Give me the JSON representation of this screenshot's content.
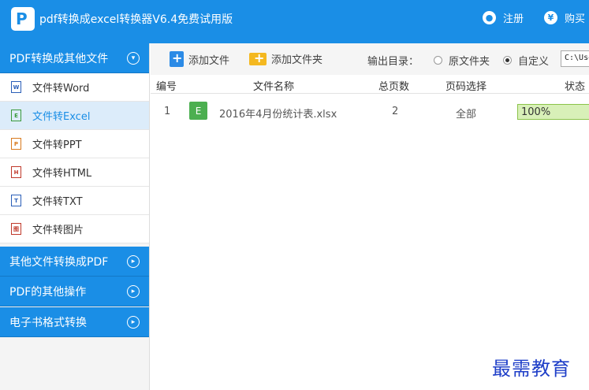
{
  "app": {
    "title": "pdf转换成excel转换器V6.4免费试用版",
    "logo_icon": "pdf-logo-icon"
  },
  "top_actions": {
    "register": "注册",
    "buy": "购买"
  },
  "sidebar": {
    "cat_pdf_to_other": "PDF转换成其他文件",
    "items": [
      {
        "label": "文件转Word",
        "icon": "W"
      },
      {
        "label": "文件转Excel",
        "icon": "E"
      },
      {
        "label": "文件转PPT",
        "icon": "P"
      },
      {
        "label": "文件转HTML",
        "icon": "H"
      },
      {
        "label": "文件转TXT",
        "icon": "T"
      },
      {
        "label": "文件转图片",
        "icon": "图"
      }
    ],
    "cat_other_to_pdf": "其他文件转换成PDF",
    "cat_pdf_ops": "PDF的其他操作",
    "cat_ebook": "电子书格式转换"
  },
  "toolbar": {
    "add_file": "添加文件",
    "add_folder": "添加文件夹",
    "output_label": "输出目录：",
    "radio_original": "原文件夹",
    "radio_custom": "自定义",
    "path_value": "C:\\Use"
  },
  "table": {
    "headers": {
      "num": "编号",
      "name": "文件名称",
      "pages": "总页数",
      "range": "页码选择",
      "status": "状态"
    },
    "rows": [
      {
        "num": "1",
        "icon": "E",
        "name": "2016年4月份统计表.xlsx",
        "pages": "2",
        "range": "全部",
        "progress": "100%"
      }
    ]
  },
  "watermark": "最需教育",
  "colors": {
    "accent": "#1a8ee6",
    "active_bg": "#dcecfa",
    "progress": "#d8f0b8",
    "watermark": "#1f3fc8"
  }
}
